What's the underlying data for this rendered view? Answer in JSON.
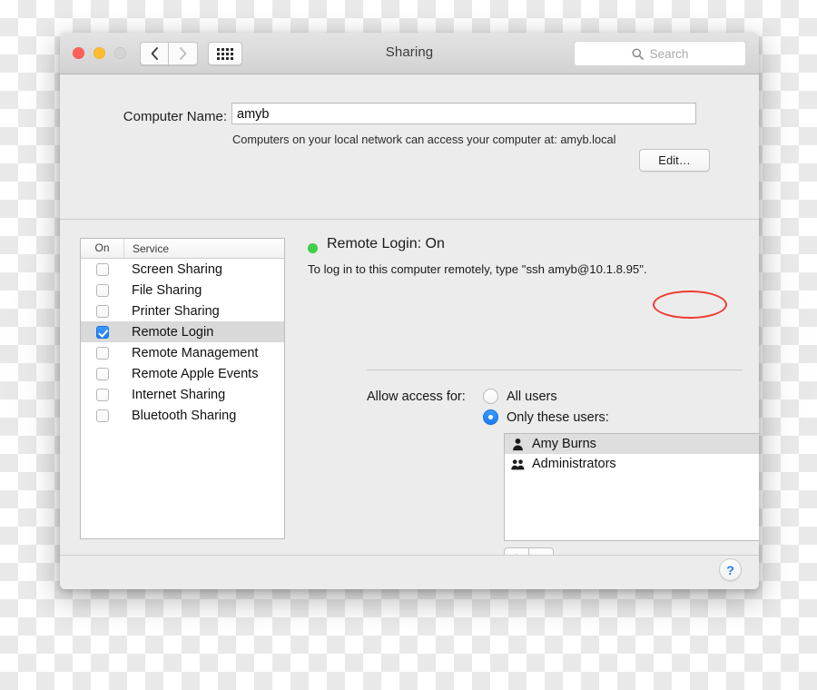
{
  "window": {
    "title": "Sharing",
    "traffic_lights": [
      "close",
      "minimize",
      "zoom"
    ],
    "nav_back": "‹",
    "nav_forward": "›",
    "search_placeholder": "Search"
  },
  "computer_name": {
    "label": "Computer Name:",
    "value": "amyb",
    "help_text": "Computers on your local network can access your computer at: amyb.local",
    "edit_button": "Edit…"
  },
  "service_table": {
    "columns": [
      "On",
      "Service"
    ],
    "rows": [
      {
        "name": "Screen Sharing",
        "on": false,
        "selected": false
      },
      {
        "name": "File Sharing",
        "on": false,
        "selected": false
      },
      {
        "name": "Printer Sharing",
        "on": false,
        "selected": false
      },
      {
        "name": "Remote Login",
        "on": true,
        "selected": true
      },
      {
        "name": "Remote Management",
        "on": false,
        "selected": false
      },
      {
        "name": "Remote Apple Events",
        "on": false,
        "selected": false
      },
      {
        "name": "Internet Sharing",
        "on": false,
        "selected": false
      },
      {
        "name": "Bluetooth Sharing",
        "on": false,
        "selected": false
      }
    ]
  },
  "detail": {
    "status_title": "Remote Login: On",
    "status_color": "#41d146",
    "ssh_instruction": "To log in to this computer remotely, type \"ssh amyb@10.1.8.95\".",
    "annotation": {
      "shape": "ellipse",
      "color": "#ee3b33",
      "encircled_text": "@10.1.8.95\""
    },
    "allow_access_label": "Allow access for:",
    "access_options": [
      {
        "label": "All users",
        "selected": false
      },
      {
        "label": "Only these users:",
        "selected": true
      }
    ],
    "users": [
      {
        "name": "Amy Burns",
        "icon": "person-icon",
        "selected": true
      },
      {
        "name": "Administrators",
        "icon": "group-icon",
        "selected": false
      }
    ],
    "add_button": "+",
    "remove_button": "−"
  },
  "bottom": {
    "help_button": "?"
  }
}
